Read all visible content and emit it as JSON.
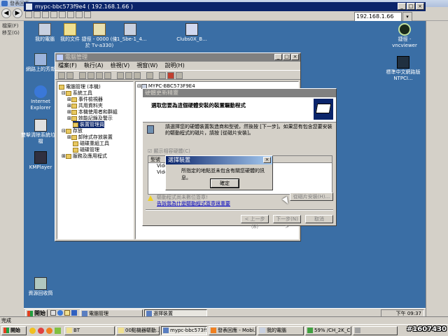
{
  "host": {
    "window_title": "發表回應",
    "left_labels": [
      "檔案(F)",
      "移至(G)"
    ],
    "status_text": "完成",
    "taskbar": {
      "start": "開始",
      "tasks": [
        "BT",
        "00點機器驅動...",
        "mypc-bbc573f9e...",
        "發表回應 - Mobi...",
        "我的電腦",
        "59% /CH_2K_C...",
        ""
      ],
      "watermark": "#1607430"
    }
  },
  "remote": {
    "window_title": "mypc-bbc573f9e4 ( 192.168.1.66 )",
    "address": "192.168.1.66",
    "desktop_icons": [
      {
        "label": "我的電腦"
      },
      {
        "label": "我的文件"
      },
      {
        "label": "捷徑 - 0000 (位於 Tv-a330)"
      },
      {
        "label": "41_Sbe-1_4..."
      },
      {
        "label": "Clubs0X_B..."
      },
      {
        "label": "網路上的芳鄰"
      },
      {
        "label": "Internet Explorer"
      },
      {
        "label": "雙擊清除系統垃圾檔"
      },
      {
        "label": "KMPlayer"
      },
      {
        "label": "資源回收筒"
      },
      {
        "label": "捷徑 - vncviewer"
      },
      {
        "label": "標準中文網路版 NTPCI..."
      }
    ],
    "taskbar": {
      "start": "開始",
      "tasks": [
        "電腦管理",
        "選擇裝置"
      ],
      "clock": "下午 09:37"
    }
  },
  "computer_management": {
    "title": "電腦管理",
    "menu": [
      "檔案(F)",
      "執行(A)",
      "檢視(V)",
      "視窗(W)",
      "說明(H)"
    ],
    "tree": [
      "電腦管理 (本機)",
      "系統工具",
      "事件檢視器",
      "共用資料夾",
      "本機使用者和群組",
      "效能記錄及警示",
      "裝置管理員",
      "存放",
      "卸除式存放裝置",
      "磁碟重組工具",
      "磁碟管理",
      "服務及應用程式"
    ],
    "right_root": "MYPC-BBC573F9E4"
  },
  "hardware_wizard": {
    "title": "硬體更新精靈",
    "header": "選取您要為這個硬體安裝的裝置驅動程式",
    "body": "請選擇您的硬體裝置製造商和型號，然後按 [下一步]。如果您有包含您要安裝的驅動程式的磁片，請按 [從磁片安裝]。",
    "checkbox_label": "顯示相容硬體(C)",
    "list_header": "型號",
    "list_items": [
      "Video Gra",
      "Video Gra"
    ],
    "warning_text": "驅動程式尚未數位簽章!",
    "link_text": "告訴我為什麼驅動程式簽章很重要",
    "have_disk_button": "從磁片安裝(H)...",
    "back_button": "< 上一步(B)",
    "next_button": "下一步(N) >",
    "cancel_button": "取消"
  },
  "select_device_dialog": {
    "title": "選擇裝置",
    "message": "所指定的地點並未包含有關您硬體的訊息。",
    "ok_button": "確定"
  }
}
